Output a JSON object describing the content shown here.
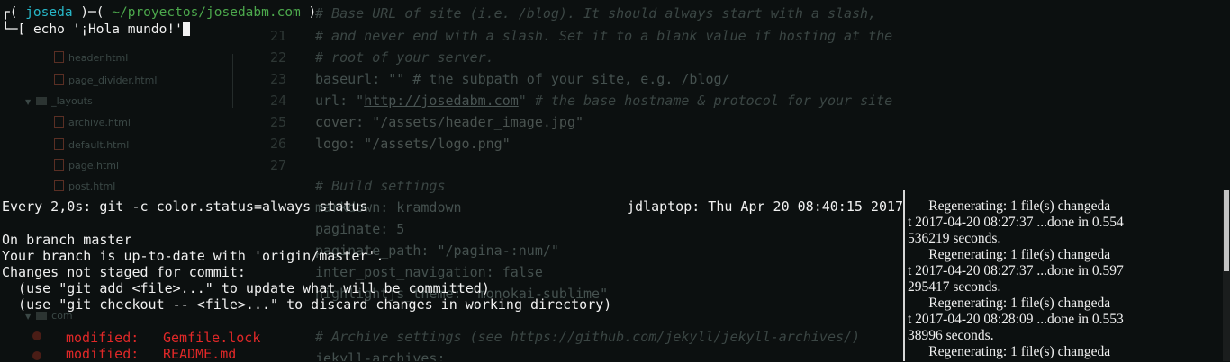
{
  "background": {
    "tree": [
      {
        "label": "header.html",
        "type": "file"
      },
      {
        "label": "page_divider.html",
        "type": "file"
      },
      {
        "label": "_layouts",
        "type": "folder"
      },
      {
        "label": "archive.html",
        "type": "file"
      },
      {
        "label": "default.html",
        "type": "file"
      },
      {
        "label": "page.html",
        "type": "file"
      },
      {
        "label": "post.html",
        "type": "file"
      },
      {
        "label": "com",
        "type": "folder"
      }
    ],
    "code": [
      {
        "ln": "",
        "text": "# Base URL of site (i.e. /blog). It should always start with a slash,"
      },
      {
        "ln": "21",
        "text": "# and never end with a slash. Set it to a blank value if hosting at the"
      },
      {
        "ln": "22",
        "text": "# root of your server."
      },
      {
        "ln": "23",
        "text": "baseurl: \"\" # the subpath of your site, e.g. /blog/"
      },
      {
        "ln": "24",
        "text_key": "url: \"",
        "link": "http://josedabm.com",
        "text_rest": "\" # the base hostname & protocol for your site"
      },
      {
        "ln": "25",
        "text": "cover: \"/assets/header_image.jpg\""
      },
      {
        "ln": "26",
        "text": "logo: \"/assets/logo.png\""
      },
      {
        "ln": "27",
        "text": ""
      },
      {
        "ln": "",
        "text": "# Build settings"
      },
      {
        "ln": "",
        "text": "markdown: kramdown"
      },
      {
        "ln": "",
        "text": "paginate: 5"
      },
      {
        "ln": "",
        "text": "paginate_path: \"/pagina-:num/\""
      },
      {
        "ln": "",
        "text": "inter_post_navigation: false"
      },
      {
        "ln": "",
        "text": "highlightjs_theme: \"monokai-sublime\""
      },
      {
        "ln": "",
        "text": ""
      },
      {
        "ln": "",
        "text": "# Archive settings (see https://github.com/jekyll/jekyll-archives/)"
      },
      {
        "ln": "",
        "text": "jekyll-archives:"
      }
    ]
  },
  "top_pane": {
    "prompt": {
      "open": "┌(",
      "user": "joseda",
      "mid": ")─(",
      "path": "~/proyectos/josedabm.com",
      "close": ")"
    },
    "command_line": {
      "prefix": "└─[",
      "command": "echo '¡Hola mundo!'"
    }
  },
  "left_pane": {
    "header_left": "Every 2,0s: git -c color.status=always status",
    "header_right": "jdlaptop: Thu Apr 20 08:40:15 2017",
    "lines": [
      "On branch master",
      "Your branch is up-to-date with 'origin/master'.",
      "Changes not staged for commit:",
      "  (use \"git add <file>...\" to update what will be committed)",
      "  (use \"git checkout -- <file>...\" to discard changes in working directory)"
    ],
    "modified": [
      {
        "status": "modified:",
        "file": "Gemfile.lock"
      },
      {
        "status": "modified:",
        "file": "README.md"
      }
    ]
  },
  "right_pane": {
    "lines": [
      "      Regenerating: 1 file(s) changeda",
      "t 2017-04-20 08:27:37 ...done in 0.554",
      "536219 seconds.",
      "      Regenerating: 1 file(s) changeda",
      "t 2017-04-20 08:27:37 ...done in 0.597",
      "295417 seconds.",
      "      Regenerating: 1 file(s) changeda",
      "t 2017-04-20 08:28:09 ...done in 0.553",
      "38996 seconds.",
      "      Regenerating: 1 file(s) changeda"
    ]
  },
  "colors": {
    "prompt_user": "#27b7c8",
    "prompt_path": "#4ca84c",
    "modified": "#e02828",
    "background": "#0c1010"
  }
}
